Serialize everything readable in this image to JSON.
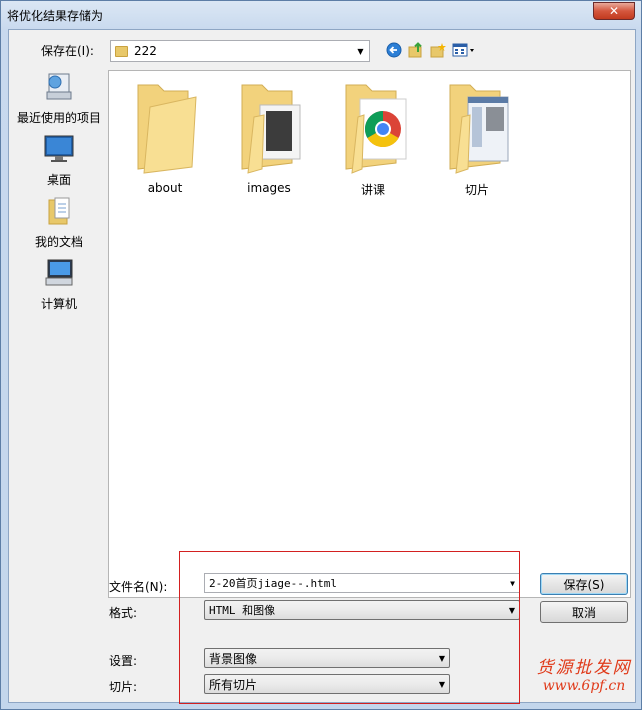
{
  "window": {
    "title": "将优化结果存储为",
    "close_glyph": "✕"
  },
  "save_in": {
    "label": "保存在(I):",
    "value": "222"
  },
  "places": [
    {
      "label": "最近使用的项目",
      "icon": "recent-items-icon"
    },
    {
      "label": "桌面",
      "icon": "desktop-icon"
    },
    {
      "label": "我的文档",
      "icon": "documents-icon"
    },
    {
      "label": "计算机",
      "icon": "computer-icon"
    }
  ],
  "folders": [
    {
      "label": "about"
    },
    {
      "label": "images"
    },
    {
      "label": "讲课"
    },
    {
      "label": "切片"
    }
  ],
  "form": {
    "filename_label": "文件名(N):",
    "filename_value": "2-20首页jiage--.html",
    "format_label": "格式:",
    "format_value": "HTML 和图像",
    "settings_label": "设置:",
    "settings_value": "背景图像",
    "slices_label": "切片:",
    "slices_value": "所有切片"
  },
  "buttons": {
    "save": "保存(S)",
    "cancel": "取消"
  },
  "watermark": {
    "line1": "货源批发网",
    "line2": "www.6pf.cn"
  },
  "colors": {
    "highlight_box": "#d32020",
    "watermark": "#e03a1a"
  }
}
